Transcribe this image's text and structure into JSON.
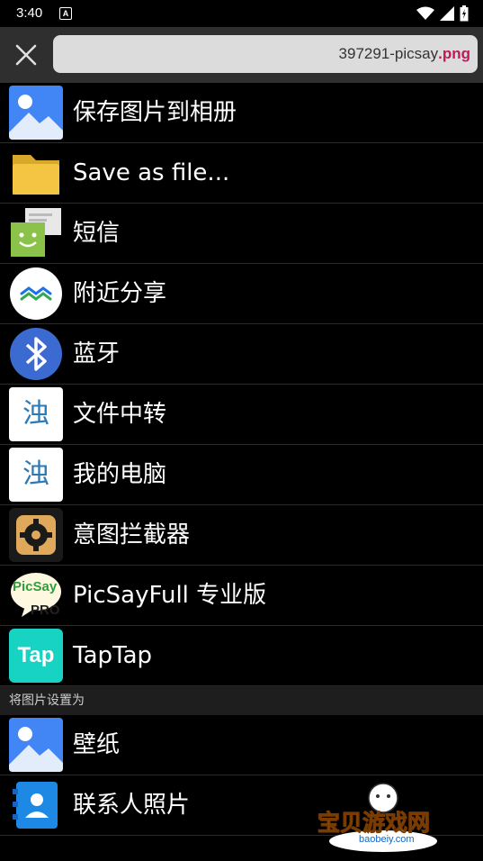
{
  "status": {
    "time": "3:40",
    "notif_letter": "A"
  },
  "header": {
    "filename_base": "397291-picsay",
    "filename_ext": ".png"
  },
  "share_items": [
    {
      "label": "保存图片到相册"
    },
    {
      "label": "Save as file..."
    },
    {
      "label": "短信"
    },
    {
      "label": "附近分享"
    },
    {
      "label": "蓝牙"
    },
    {
      "label": "文件中转"
    },
    {
      "label": "我的电脑"
    },
    {
      "label": "意图拦截器"
    },
    {
      "label": "PicSayFull 专业版"
    },
    {
      "label": "TapTap"
    }
  ],
  "set_as_section": {
    "title": "将图片设置为"
  },
  "set_as_items": [
    {
      "label": "壁纸"
    },
    {
      "label": "联系人照片"
    }
  ],
  "icon_texts": {
    "picsay_top": "PicSay",
    "picsay_bottom": "PRO",
    "taptap": "Tap",
    "wenjian": "浊"
  },
  "watermark": {
    "title": "宝贝游戏网",
    "url": "baobeiy.com"
  },
  "colors": {
    "accent_ext": "#c2185b",
    "topbar": "#2f2f2f",
    "background": "#000000"
  }
}
